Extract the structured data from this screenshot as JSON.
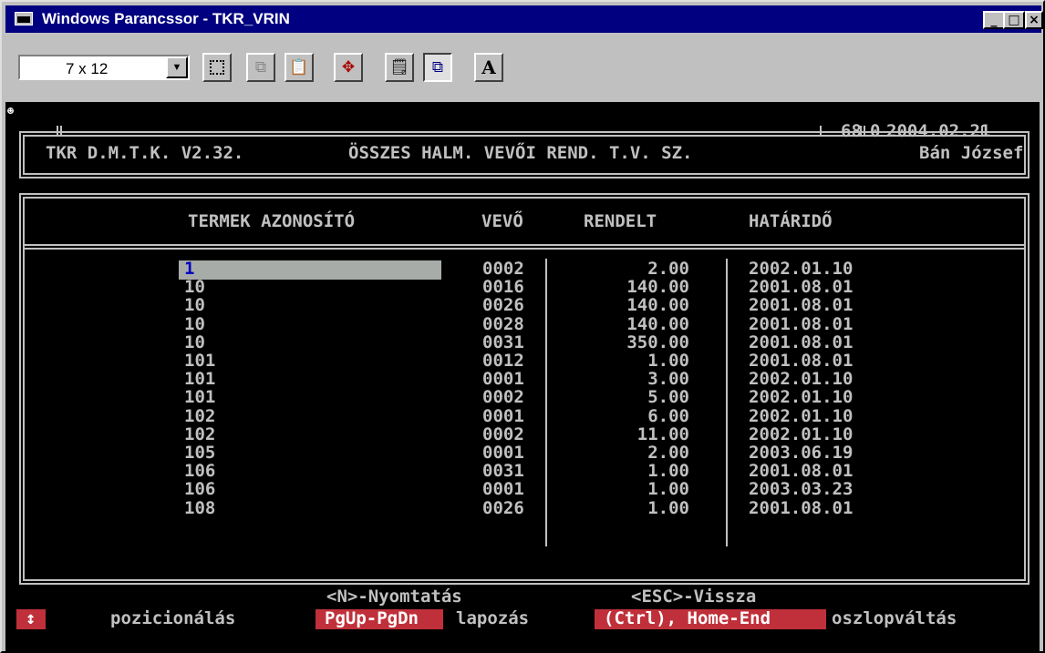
{
  "window": {
    "title": "Windows Parancssor - TKR_VRIN",
    "min_glyph": "_",
    "max_glyph": "□",
    "close_glyph": "×"
  },
  "toolbar": {
    "font_size": "7 x 12",
    "dropdown_glyph": "▼",
    "buttons": [
      "mark",
      "copy",
      "paste",
      "fullscreen",
      "properties",
      "background",
      "font"
    ],
    "font_button_label": "A"
  },
  "console": {
    "indicator": "☻",
    "header": {
      "app": "TKR D.M.T.K. V2.32.",
      "report": "ÖSSZES HALM. VEVŐI REND. T.V. SZ.",
      "num1": "68",
      "num2": "0",
      "date": "2004.02.21",
      "user": "Bán József"
    },
    "columns": [
      "TERMEK AZONOSÍTÓ",
      "VEVŐ",
      "RENDELT",
      "HATÁRIDŐ"
    ],
    "rows": [
      [
        "1",
        "0002",
        "2.00",
        "2002.01.10"
      ],
      [
        "10",
        "0016",
        "140.00",
        "2001.08.01"
      ],
      [
        "10",
        "0026",
        "140.00",
        "2001.08.01"
      ],
      [
        "10",
        "0028",
        "140.00",
        "2001.08.01"
      ],
      [
        "10",
        "0031",
        "350.00",
        "2001.08.01"
      ],
      [
        "101",
        "0012",
        "1.00",
        "2001.08.01"
      ],
      [
        "101",
        "0001",
        "3.00",
        "2002.01.10"
      ],
      [
        "101",
        "0002",
        "5.00",
        "2002.01.10"
      ],
      [
        "102",
        "0001",
        "6.00",
        "2002.01.10"
      ],
      [
        "102",
        "0002",
        "11.00",
        "2002.01.10"
      ],
      [
        "105",
        "0001",
        "2.00",
        "2003.06.19"
      ],
      [
        "106",
        "0031",
        "1.00",
        "2001.08.01"
      ],
      [
        "106",
        "0001",
        "1.00",
        "2003.03.23"
      ],
      [
        "108",
        "0026",
        "1.00",
        "2001.08.01"
      ]
    ],
    "footer": {
      "print_key": "<N>-Nyomtatás",
      "back_key": "<ESC>-Vissza",
      "arrow_key": "↕",
      "arrow_label": "pozicionálás",
      "page_key": "PgUp-PgDn",
      "page_label": "lapozás",
      "col_key": "(Ctrl), Home-End",
      "col_label": "oszlopváltás"
    }
  }
}
